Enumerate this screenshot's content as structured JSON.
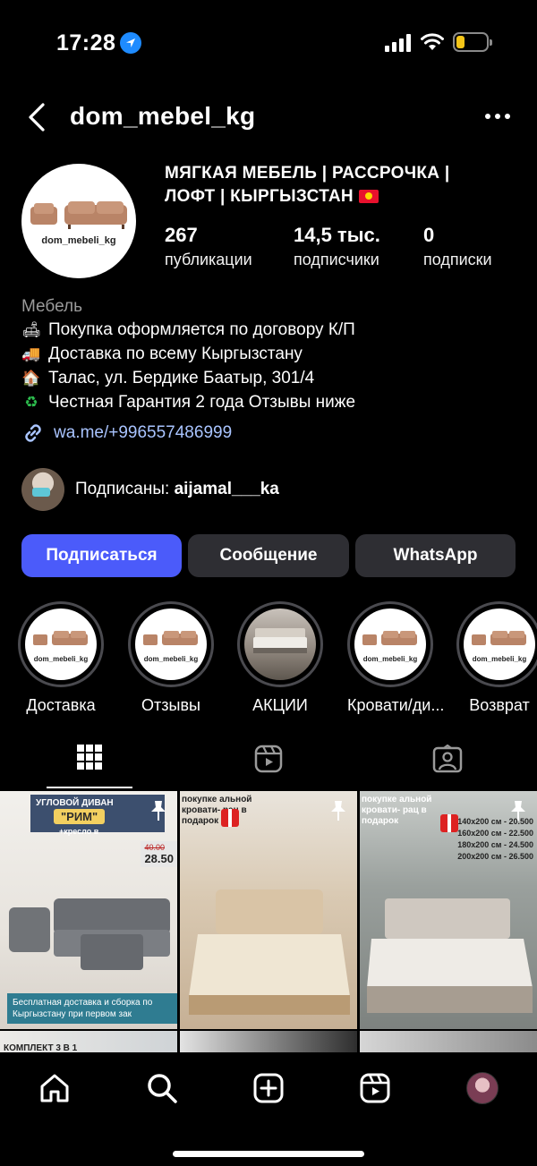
{
  "status_bar": {
    "time": "17:28"
  },
  "header": {
    "username": "dom_mebel_kg"
  },
  "profile": {
    "avatar_label": "dom_mebeli_kg",
    "title_line1": "МЯГКАЯ МЕБЕЛЬ | РАССРОЧКА |",
    "title_line2": "ЛОФТ | КЫРГЫЗСТАН",
    "stats": [
      {
        "value": "267",
        "label": "публикации"
      },
      {
        "value": "14,5 тыс.",
        "label": "подписчики"
      },
      {
        "value": "0",
        "label": "подписки"
      }
    ],
    "category": "Мебель",
    "bio_lines": [
      "Покупка оформляется по договору К/П",
      "Доставка по всему Кыргызстану",
      "Талас, ул. Бердике Баатыр, 301/4",
      "Честная Гарантия 2 года Отзывы ниже"
    ],
    "link": "wa.me/+996557486999",
    "followed_prefix": "Подписаны: ",
    "followed_user": "aijamal___ka"
  },
  "actions": {
    "subscribe": "Подписаться",
    "message": "Сообщение",
    "whatsapp": "WhatsApp"
  },
  "highlights": [
    {
      "label": "Доставка",
      "mini": "dom_mebeli_kg"
    },
    {
      "label": "Отзывы",
      "mini": "dom_mebeli_kg"
    },
    {
      "label": "АКЦИИ",
      "mini": ""
    },
    {
      "label": "Кровати/ди...",
      "mini": "dom_mebeli_kg"
    },
    {
      "label": "Возврат",
      "mini": "dom_mebeli_kg"
    }
  ],
  "posts": {
    "p1": {
      "banner_line": "УГЛОВОЙ ДИВАН",
      "name": "\"РИМ\"",
      "gift": "+кресло в",
      "old_price": "40.00",
      "price": "28.50",
      "footer": "Бесплатная доставка и сборка по Кыргызстану при первом зак"
    },
    "p2": {
      "promo": "покупке альной кровати- рац в подарок"
    },
    "p3": {
      "promo": "покупке альной кровати- рац в подарок",
      "sizes": [
        "140x200 см - 20.500",
        "160x200 см - 22.500",
        "180x200 см - 24.500",
        "200x200 см - 26.500"
      ]
    },
    "p4": {
      "label": "КОМПЛЕКТ 3 В 1"
    }
  },
  "colors": {
    "background": "#000000",
    "primary_button": "#4b5bfa",
    "secondary_button": "#2e2e33",
    "link": "#a9c4ff"
  }
}
